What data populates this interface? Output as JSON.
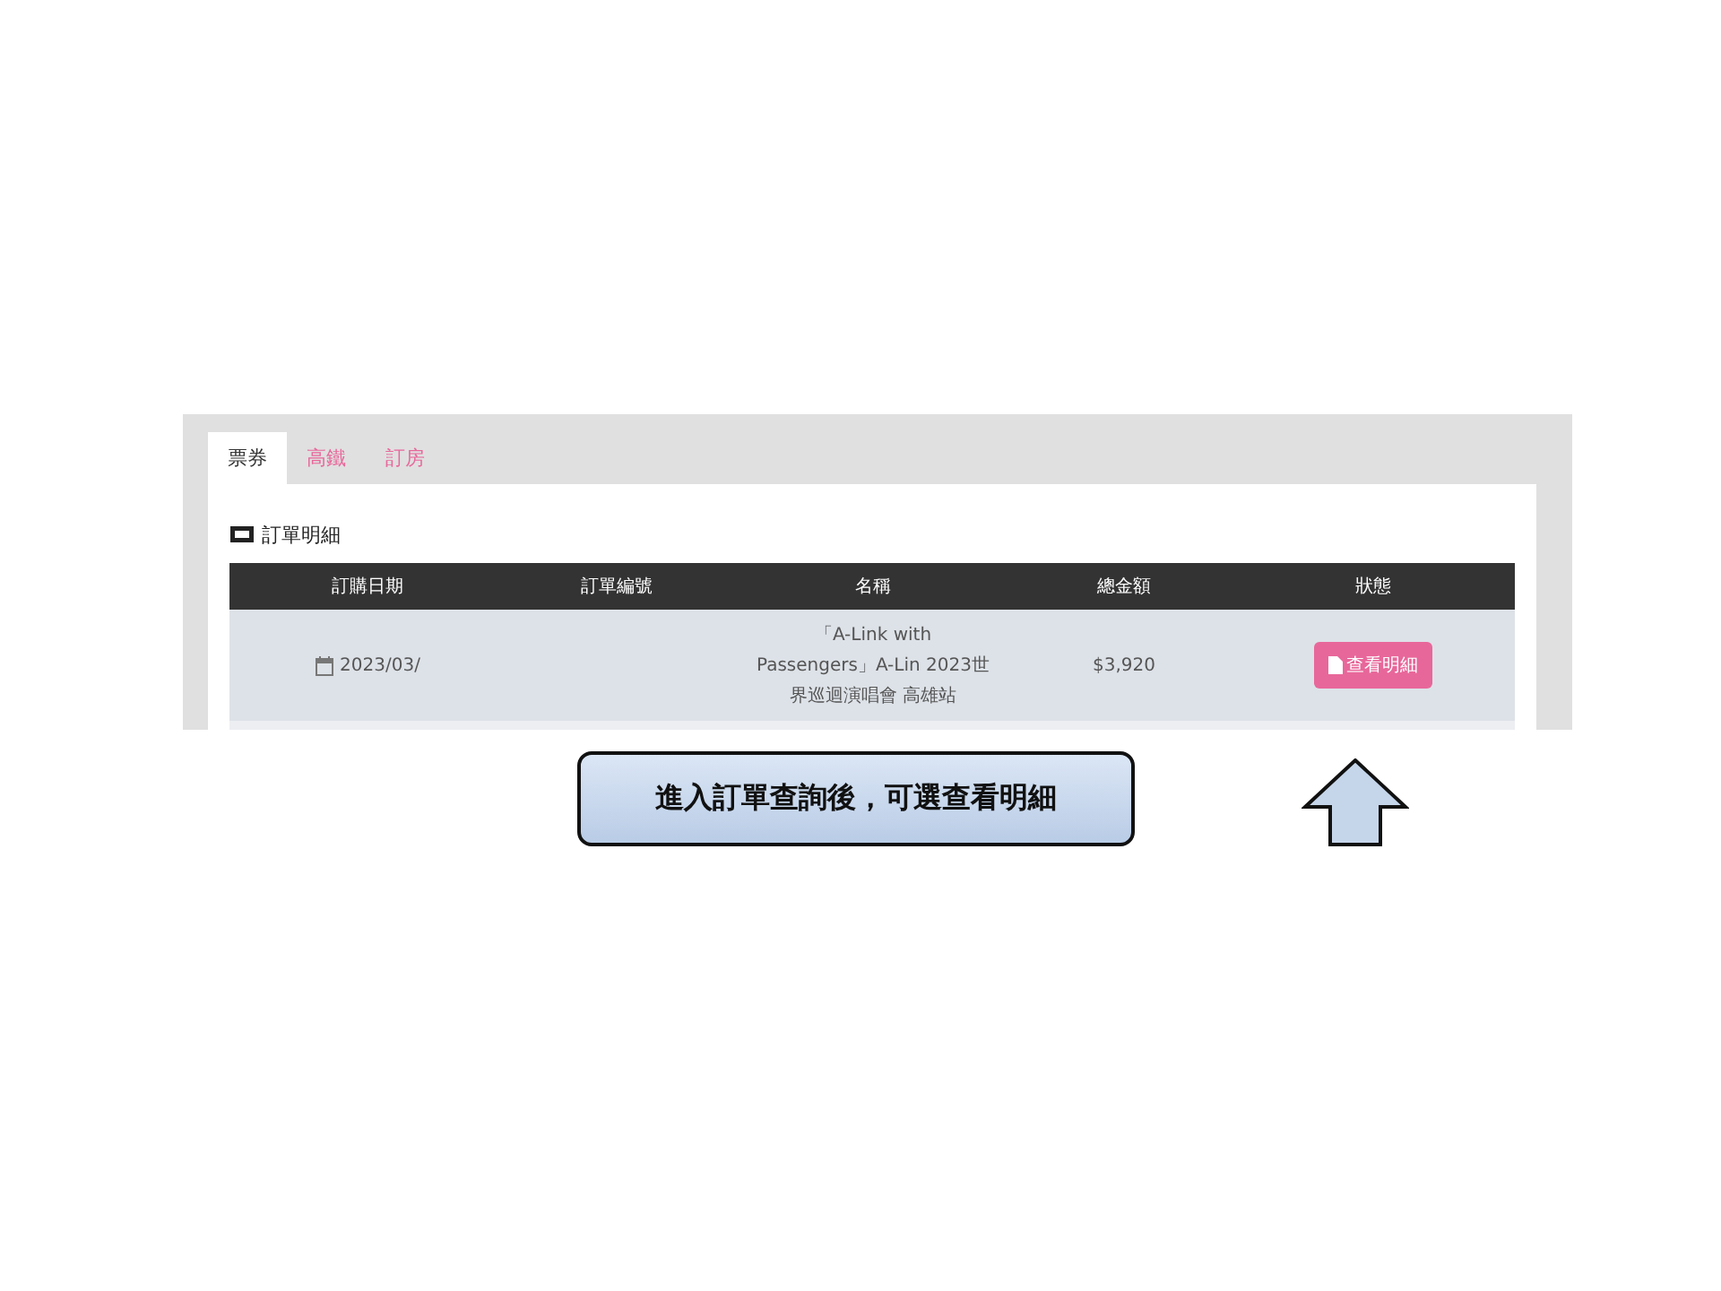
{
  "tabs": [
    {
      "label": "票券",
      "selected": true
    },
    {
      "label": "高鐵",
      "selected": false
    },
    {
      "label": "訂房",
      "selected": false
    }
  ],
  "section_title": "訂單明細",
  "table": {
    "columns": [
      "訂購日期",
      "訂單編號",
      "名稱",
      "總金額",
      "狀態"
    ],
    "rows": [
      {
        "date": "2023/03/",
        "order_number_lines": [],
        "name_lines": [
          "「A-Link  with",
          "Passengers」A-Lin  2023世",
          "界巡迴演唱會  高雄站"
        ],
        "total": "$3,920",
        "action": "查看明細"
      }
    ]
  },
  "callout": "進入訂單查詢後，可選查看明細"
}
